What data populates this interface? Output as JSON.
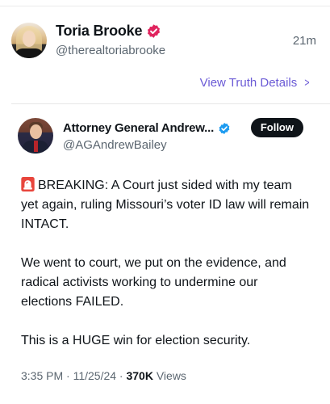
{
  "post": {
    "display_name": "Toria Brooke",
    "handle": "@therealtoriabrooke",
    "time": "21m",
    "verified_icon": "verified-badge-icon",
    "verified_color": "#e0245e"
  },
  "truth_link": {
    "label": "View Truth Details",
    "chevron": ">"
  },
  "quoted": {
    "display_name": "Attorney General Andrew...",
    "handle": "@AGAndrewBailey",
    "follow_label": "Follow",
    "verified_color": "#1d9bf0",
    "paragraphs": [
      "BREAKING: A Court just sided with my team yet again, ruling Missouri’s voter ID law will remain INTACT.",
      "We went to court, we put on the evidence, and radical activists working to undermine our elections FAILED.",
      "This is a HUGE win for election security."
    ],
    "lead_icon": "siren-icon",
    "meta": {
      "timestamp": "3:35 PM · 11/25/24 · ",
      "views_count": "370K",
      "views_label": " Views"
    }
  },
  "colors": {
    "accent_link": "#6b5bd6",
    "secondary_text": "#5b6670",
    "primary_text": "#0f1419"
  }
}
